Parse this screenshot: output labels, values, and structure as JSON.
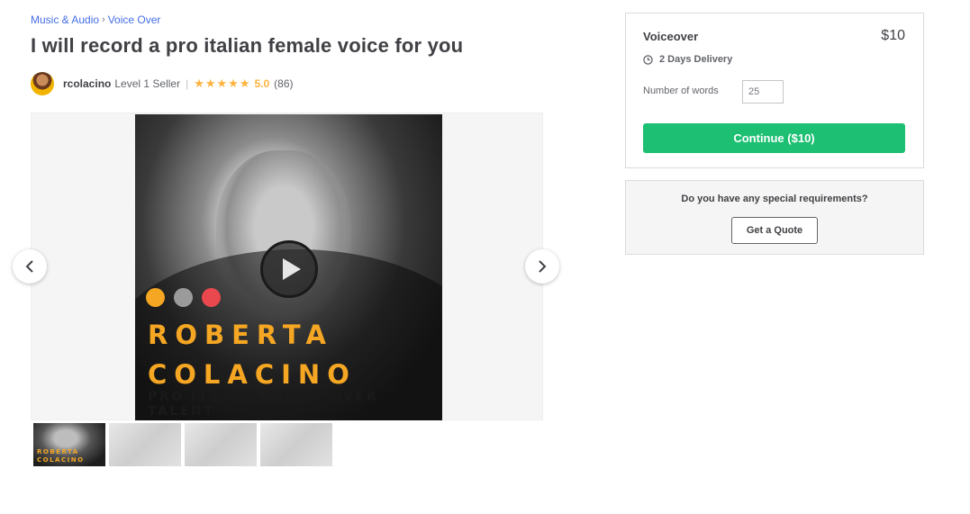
{
  "breadcrumb": {
    "category": "Music & Audio",
    "separator": "›",
    "subcategory": "Voice Over"
  },
  "gig": {
    "title": "I will record a pro italian female voice for you"
  },
  "seller": {
    "name": "rcolacino",
    "level": "Level 1 Seller",
    "separator": "|",
    "stars": "★★★★★",
    "rating": "5.0",
    "reviews": "(86)"
  },
  "gallery": {
    "slide": {
      "name_line1": "ROBERTA",
      "name_line2": "COLACINO",
      "tagline": "PRO ITALIAN VOICE OVER TALENT",
      "dot_colors": [
        "#f5a623",
        "#9b9b9b",
        "#e8484e"
      ]
    },
    "thumb_text_line1": "ROBERTA",
    "thumb_text_line2": "COLACINO"
  },
  "package": {
    "title": "Voiceover",
    "price": "$10",
    "delivery": "2 Days Delivery",
    "words_label": "Number of words",
    "words_value": "25",
    "continue_label": "Continue ($10)"
  },
  "quote": {
    "question": "Do you have any special requirements?",
    "button_label": "Get a Quote"
  },
  "colors": {
    "accent_green": "#1dbf73",
    "link_blue": "#446ee7",
    "star_yellow": "#ffb33e"
  }
}
